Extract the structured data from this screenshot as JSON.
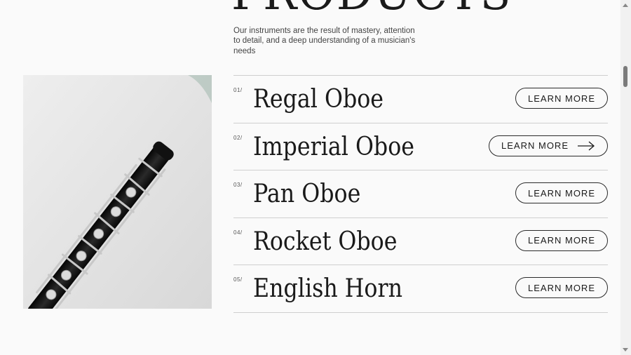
{
  "page": {
    "heading": "PRODUCTS",
    "intro": "Our instruments are the result of mastery, attention to detail, and a deep understanding of a musician's needs"
  },
  "products": [
    {
      "number": "01/",
      "name": "Regal Oboe",
      "button": "LEARN MORE",
      "hovered": false
    },
    {
      "number": "02/",
      "name": "Imperial Oboe",
      "button": "LEARN MORE",
      "hovered": true
    },
    {
      "number": "03/",
      "name": "Pan Oboe",
      "button": "LEARN MORE",
      "hovered": false
    },
    {
      "number": "04/",
      "name": "Rocket Oboe",
      "button": "LEARN MORE",
      "hovered": false
    },
    {
      "number": "05/",
      "name": "English Horn",
      "button": "LEARN MORE",
      "hovered": false
    }
  ],
  "icons": {
    "arrow": "arrow-right-icon",
    "photo": "oboe-photo"
  },
  "colors": {
    "background": "#fafafa",
    "text": "#1a1a1a",
    "divider": "#cfcfcf"
  }
}
